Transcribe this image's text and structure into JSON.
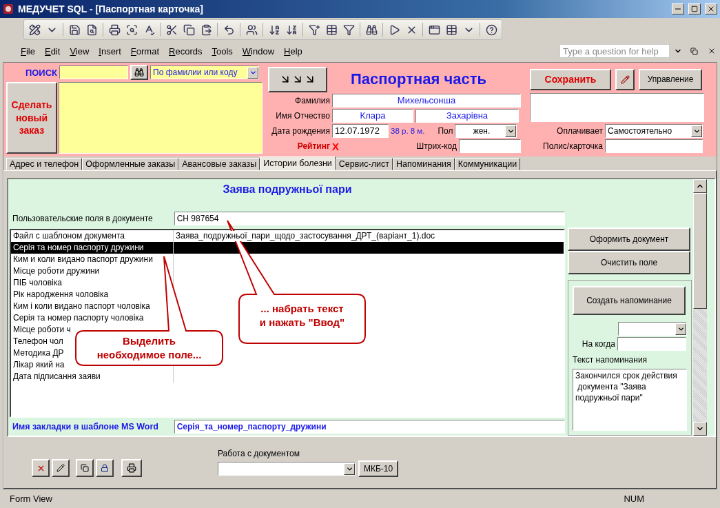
{
  "window": {
    "title": "МЕДУЧЕТ SQL - [Паспортная карточка]"
  },
  "menu": [
    "File",
    "Edit",
    "View",
    "Insert",
    "Format",
    "Records",
    "Tools",
    "Window",
    "Help"
  ],
  "help_box": {
    "placeholder": "Type a question for help"
  },
  "search": {
    "label": "ПОИСК",
    "mode": "По фамилии или коду"
  },
  "new_order_button": "Сделать новый заказ",
  "section_title": "Паспортная часть",
  "save_button": "Сохранить",
  "manage_button": "Управление",
  "patient": {
    "surname_label": "Фамилия",
    "surname": "Михельсонша",
    "name_label": "Имя Отчество",
    "first_name": "Клара",
    "patronymic": "Захарівна",
    "birth_label": "Дата рождения",
    "birth_date": "12.07.1972",
    "age": "38 р. 8 м.",
    "sex_label": "Пол",
    "sex": "жен.",
    "rating_label": "Рейтинг",
    "rating": "X",
    "barcode_label": "Штрих-код",
    "payer_label": "Оплачивает",
    "payer": "Самостоятельно",
    "policy_label": "Полис/карточка"
  },
  "tabs": [
    {
      "label": "Адрес и телефон",
      "selected": false
    },
    {
      "label": "Оформленные заказы",
      "selected": false
    },
    {
      "label": "Авансовые заказы",
      "selected": false
    },
    {
      "label": "Истории болезни",
      "selected": true
    },
    {
      "label": "Сервис-лист",
      "selected": false
    },
    {
      "label": "Напоминания",
      "selected": false
    },
    {
      "label": "Коммуникации",
      "selected": false
    }
  ],
  "document": {
    "title": "Заява подружньої пари",
    "custom_fields_label": "Пользовательские поля в документе",
    "custom_field_value": "СН 987654",
    "fields": [
      {
        "name": "Файл с шаблоном документа",
        "value": "Заява_подружньої_пари_щодо_застосування_ДРТ_(варіант_1).doc",
        "selected": false
      },
      {
        "name": "Серія та номер паспорту дружини",
        "selected": true
      },
      {
        "name": "Ким и коли видано паспорт дружини",
        "selected": false
      },
      {
        "name": "Місце роботи дружини",
        "selected": false
      },
      {
        "name": "ПІБ чоловіка",
        "selected": false
      },
      {
        "name": "Рік народження чоловіка",
        "selected": false
      },
      {
        "name": "Ким і коли видано паспорт чоловіка",
        "selected": false
      },
      {
        "name": "Серія та номер паспорту чоловіка",
        "selected": false
      },
      {
        "name": "Місце роботи ч",
        "selected": false
      },
      {
        "name": "Телефон чол",
        "selected": false
      },
      {
        "name": "Методика ДР",
        "selected": false
      },
      {
        "name": "Лікар який на",
        "selected": false
      },
      {
        "name": "Дата підписання заяви",
        "selected": false
      }
    ],
    "bookmark_label": "Имя закладки в шаблоне MS Word",
    "bookmark_value": "Серія_та_номер_паспорту_дружини"
  },
  "doc_buttons": [
    "Оформить документ",
    "Очистить поле"
  ],
  "reminder": {
    "button": "Создать напоминание",
    "when_label": "На когда",
    "text_label": "Текст напоминания",
    "text": "Закончился срок действия\n документа \"Заява\nподружньої пари\""
  },
  "callouts": [
    {
      "text": "Выделить\nнеобходимое поле..."
    },
    {
      "text": "... набрать текст\nи нажать \"Ввод\""
    }
  ],
  "work_label": "Работа с документом",
  "icd_button": "МКБ-10",
  "status_bar": {
    "mode": "Form View",
    "num": "NUM"
  }
}
